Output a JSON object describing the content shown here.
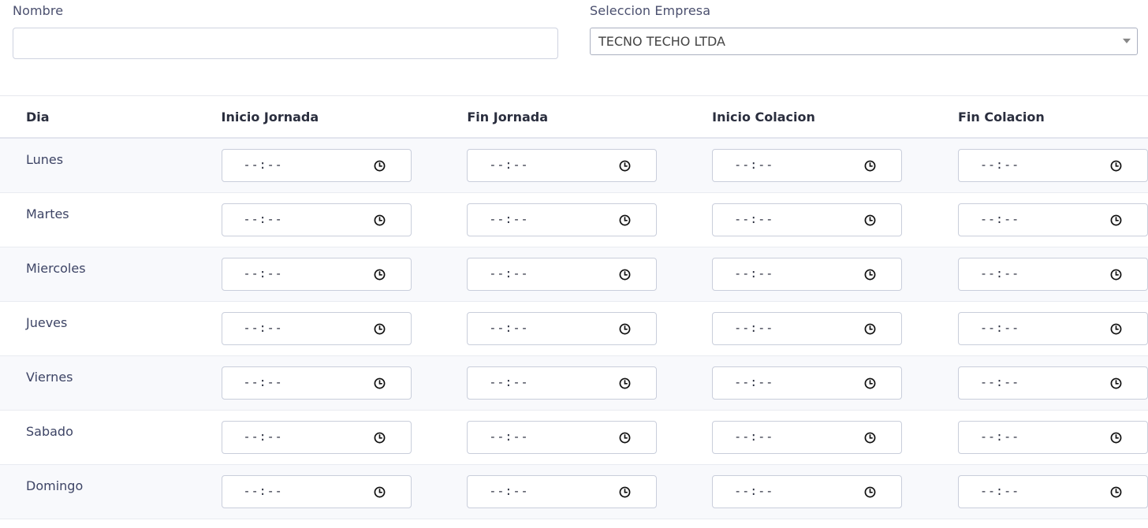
{
  "form": {
    "nombre_label": "Nombre",
    "nombre_value": "",
    "empresa_label": "Seleccion Empresa",
    "empresa_selected": "TECNO TECHO LTDA"
  },
  "table": {
    "headers": [
      "Dia",
      "Inicio Jornada",
      "Fin Jornada",
      "Inicio Colacion",
      "Fin Colacion"
    ],
    "rows": [
      {
        "day": "Lunes",
        "times": [
          "--:--",
          "--:--",
          "--:--",
          "--:--"
        ]
      },
      {
        "day": "Martes",
        "times": [
          "--:--",
          "--:--",
          "--:--",
          "--:--"
        ]
      },
      {
        "day": "Miercoles",
        "times": [
          "--:--",
          "--:--",
          "--:--",
          "--:--"
        ]
      },
      {
        "day": "Jueves",
        "times": [
          "--:--",
          "--:--",
          "--:--",
          "--:--"
        ]
      },
      {
        "day": "Viernes",
        "times": [
          "--:--",
          "--:--",
          "--:--",
          "--:--"
        ]
      },
      {
        "day": "Sabado",
        "times": [
          "--:--",
          "--:--",
          "--:--",
          "--:--"
        ]
      },
      {
        "day": "Domingo",
        "times": [
          "--:--",
          "--:--",
          "--:--",
          "--:--"
        ]
      }
    ]
  }
}
